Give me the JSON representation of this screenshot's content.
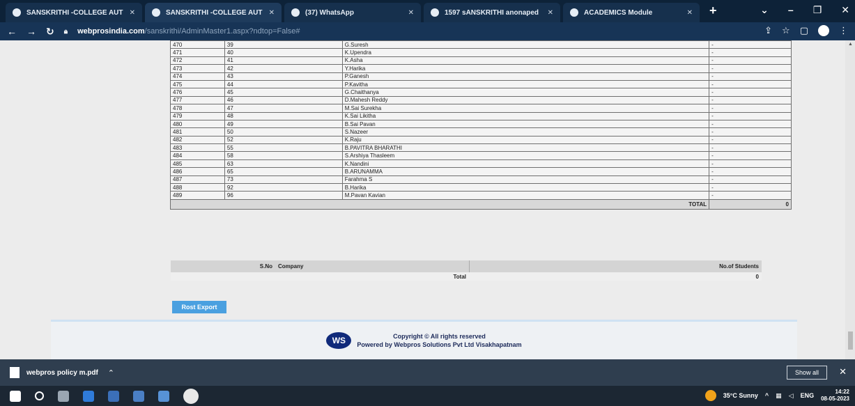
{
  "browser": {
    "tabs": [
      {
        "label": "SANSKRITHI -COLLEGE AUT"
      },
      {
        "label": "SANSKRITHI -COLLEGE AUT"
      },
      {
        "label": "(37) WhatsApp"
      },
      {
        "label": "1597 sANSKRITHI anonaped"
      },
      {
        "label": "ACADEMICS Module"
      }
    ],
    "url_host": "webprosindia.com",
    "url_path": "/sanskrithi/AdminMaster1.aspx?ndtop=False#"
  },
  "table": {
    "rows": [
      {
        "sno": "470",
        "roll": "39",
        "name": "G.Suresh",
        "value": "-"
      },
      {
        "sno": "471",
        "roll": "40",
        "name": "K.Upendra",
        "value": "-"
      },
      {
        "sno": "472",
        "roll": "41",
        "name": "K.Asha",
        "value": "-"
      },
      {
        "sno": "473",
        "roll": "42",
        "name": "Y.Harika",
        "value": "-"
      },
      {
        "sno": "474",
        "roll": "43",
        "name": "P.Ganesh",
        "value": "-"
      },
      {
        "sno": "475",
        "roll": "44",
        "name": "P.Kavitha",
        "value": "-"
      },
      {
        "sno": "476",
        "roll": "45",
        "name": "G.Chaithanya",
        "value": "-"
      },
      {
        "sno": "477",
        "roll": "46",
        "name": "D.Mahesh Reddy",
        "value": "-"
      },
      {
        "sno": "478",
        "roll": "47",
        "name": "M.Sai Surekha",
        "value": "-"
      },
      {
        "sno": "479",
        "roll": "48",
        "name": "K.Sai Likitha",
        "value": "-"
      },
      {
        "sno": "480",
        "roll": "49",
        "name": "B.Sai Pavan",
        "value": "-"
      },
      {
        "sno": "481",
        "roll": "50",
        "name": "S.Nazeer",
        "value": "-"
      },
      {
        "sno": "482",
        "roll": "52",
        "name": "K.Raju",
        "value": "-"
      },
      {
        "sno": "483",
        "roll": "55",
        "name": "B.PAVITRA BHARATHI",
        "value": "-"
      },
      {
        "sno": "484",
        "roll": "58",
        "name": "S.Arshiya Thasleem",
        "value": "-"
      },
      {
        "sno": "485",
        "roll": "63",
        "name": "K.Nandini",
        "value": "-"
      },
      {
        "sno": "486",
        "roll": "65",
        "name": "B.ARUNAMMA",
        "value": "-"
      },
      {
        "sno": "487",
        "roll": "73",
        "name": "Farahma S",
        "value": "-"
      },
      {
        "sno": "488",
        "roll": "92",
        "name": "B.Harika",
        "value": "-"
      },
      {
        "sno": "489",
        "roll": "96",
        "name": "M.Pavan Kavian",
        "value": "-"
      }
    ],
    "total_label": "TOTAL",
    "total_value": "0"
  },
  "company_table": {
    "headers": {
      "sno": "S.No",
      "company": "Company",
      "students": "No.of Students"
    },
    "total_label": "Total",
    "total_value": "0"
  },
  "export_button": "Rost Export",
  "footer": {
    "logo_text": "WS",
    "line1": "Copyright ©   All rights reserved",
    "line2": "Powered by Webpros Solutions Pvt Ltd   Visakhapatnam"
  },
  "download_bar": {
    "file_name": "webpros policy m.pdf",
    "show_all": "Show all"
  },
  "taskbar": {
    "weather": "35°C Sunny",
    "lang": "ENG",
    "time": "14:22",
    "date": "08-05-2023"
  },
  "colors": {
    "tab_bar": "#0d2238",
    "toolbar": "#173456",
    "export_button": "#4aa0e0",
    "footer_logo": "#102a7a"
  }
}
